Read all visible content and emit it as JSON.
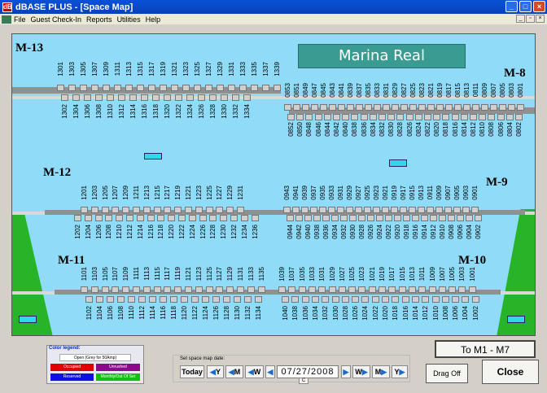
{
  "window": {
    "title": "dBASE PLUS - [Space Map]"
  },
  "menu": [
    "File",
    "Guest Check-In",
    "Reports",
    "Utilities",
    "Help"
  ],
  "map": {
    "banner": "Marina Real",
    "docks": {
      "m13": "M-13",
      "m12": "M-12",
      "m11": "M-11",
      "m8": "M-8",
      "m9": "M-9",
      "m10": "M-10"
    },
    "slips": {
      "m13_top": [
        "1301",
        "1303",
        "1305",
        "1307",
        "1309",
        "1311",
        "1313",
        "1315",
        "1317",
        "1319",
        "1321",
        "1323",
        "1325",
        "1327",
        "1329",
        "1331",
        "1333",
        "1335",
        "1337",
        "1339"
      ],
      "m13_bot": [
        "1302",
        "1304",
        "1306",
        "1308",
        "1310",
        "1312",
        "1314",
        "1316",
        "1318",
        "1320",
        "1322",
        "1324",
        "1326",
        "1328",
        "1330",
        "1332",
        "1334"
      ],
      "m8_top": [
        "0853",
        "0851",
        "0849",
        "0847",
        "0845",
        "0843",
        "0841",
        "0839",
        "0837",
        "0835",
        "0833",
        "0831",
        "0829",
        "0827",
        "0825",
        "0823",
        "0821",
        "0819",
        "0817",
        "0815",
        "0813",
        "0811",
        "0809",
        "0807",
        "0805",
        "0803",
        "0801"
      ],
      "m8_bot": [
        "0852",
        "0850",
        "0848",
        "0846",
        "0844",
        "0842",
        "0840",
        "0838",
        "0836",
        "0834",
        "0832",
        "0830",
        "0828",
        "0826",
        "0824",
        "0822",
        "0820",
        "0818",
        "0816",
        "0814",
        "0812",
        "0810",
        "0808",
        "0806",
        "0804",
        "0802"
      ],
      "m12_top": [
        "1201",
        "1203",
        "1205",
        "1207",
        "1209",
        "1211",
        "1213",
        "1215",
        "1217",
        "1219",
        "1221",
        "1223",
        "1225",
        "1227",
        "1229",
        "1231"
      ],
      "m12_bot": [
        "1202",
        "1204",
        "1206",
        "1208",
        "1210",
        "1212",
        "1214",
        "1216",
        "1218",
        "1220",
        "1222",
        "1224",
        "1226",
        "1228",
        "1230",
        "1232",
        "1234",
        "1236"
      ],
      "m9_top": [
        "0943",
        "0941",
        "0939",
        "0937",
        "0935",
        "0933",
        "0931",
        "0929",
        "0927",
        "0925",
        "0923",
        "0921",
        "0919",
        "0917",
        "0915",
        "0913",
        "0911",
        "0909",
        "0907",
        "0905",
        "0903",
        "0901"
      ],
      "m9_bot": [
        "0944",
        "0942",
        "0940",
        "0938",
        "0936",
        "0934",
        "0932",
        "0930",
        "0928",
        "0926",
        "0924",
        "0922",
        "0920",
        "0918",
        "0916",
        "0914",
        "0912",
        "0910",
        "0908",
        "0906",
        "0904",
        "0902"
      ],
      "m11_top": [
        "1101",
        "1103",
        "1105",
        "1107",
        "1109",
        "1111",
        "1113",
        "1115",
        "1117",
        "1119",
        "1121",
        "1123",
        "1125",
        "1127",
        "1129",
        "1131",
        "1133",
        "1135"
      ],
      "m11_bot": [
        "1102",
        "1104",
        "1106",
        "1108",
        "1110",
        "1112",
        "1114",
        "1116",
        "1118",
        "1120",
        "1122",
        "1124",
        "1126",
        "1128",
        "1130",
        "1132",
        "1134"
      ],
      "m10_top": [
        "1039",
        "1037",
        "1035",
        "1033",
        "1031",
        "1029",
        "1027",
        "1025",
        "1023",
        "1021",
        "1019",
        "1017",
        "1015",
        "1013",
        "1011",
        "1009",
        "1007",
        "1005",
        "1003",
        "1001"
      ],
      "m10_bot": [
        "1040",
        "1038",
        "1036",
        "1034",
        "1032",
        "1030",
        "1028",
        "1026",
        "1024",
        "1022",
        "1020",
        "1018",
        "1016",
        "1014",
        "1012",
        "1010",
        "1008",
        "1006",
        "1004",
        "1002"
      ]
    }
  },
  "legend": {
    "title": "Color legend:",
    "open": "Open (Grey for 50Amp)",
    "occupied": "Occupied",
    "unrushed": "Unrushed",
    "reserved": "Reserved",
    "monthly": "Monthly/Out Of Ser",
    "colors": {
      "occupied": "#e00000",
      "unrushed": "#8a0a8a",
      "reserved": "#1010e0",
      "monthly": "#10c010"
    }
  },
  "datepicker": {
    "label": "Set space map date:",
    "today": "Today",
    "y": "Y",
    "m": "M",
    "w": "W",
    "date": "07/27/2008",
    "c": "C"
  },
  "buttons": {
    "to_m1_m7": "To M1 - M7",
    "drag_off": "Drag Off",
    "close": "Close"
  }
}
